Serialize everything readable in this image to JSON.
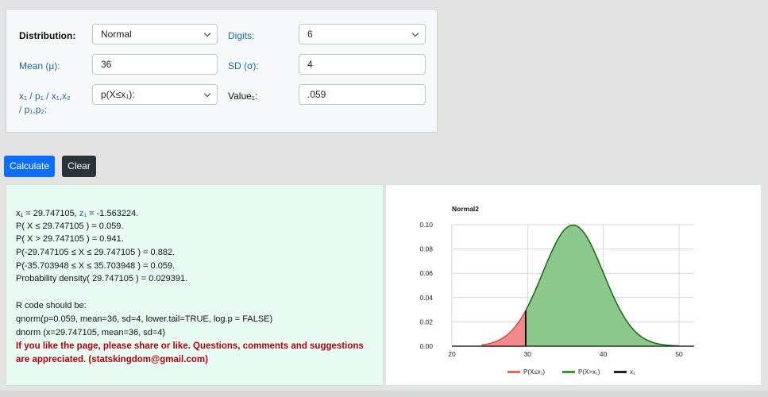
{
  "form": {
    "distribution_label": "Distribution:",
    "distribution_value": "Normal",
    "digits_label": "Digits:",
    "digits_value": "6",
    "mean_label": "Mean (μ):",
    "mean_value": "36",
    "sd_label": "SD (σ):",
    "sd_value": "4",
    "mode_label_1": "x₁ / p₁ / x₁,x₂",
    "mode_label_2": "/ p₁,p₂:",
    "mode_value": "p(X≤x₁):",
    "value1_label": "Value₁:",
    "value1_value": ".059"
  },
  "buttons": {
    "calculate": "Calculate",
    "clear": "Clear"
  },
  "results": {
    "x1_label": "x₁ = 29.747105,",
    "z1_label": "z₁",
    "z1_value": "= -1.563224.",
    "lines": [
      "P( X ≤ 29.747105 ) = 0.059.",
      "P( X > 29.747105 ) = 0.941.",
      "P(-29.747105 ≤ X ≤ 29.747105 ) = 0.882.",
      "P(-35.703948 ≤ X ≤ 35.703948 ) = 0.059.",
      "Probability density( 29.747105 ) = 0.029391."
    ],
    "r_title": "R code should be:",
    "r_lines": [
      "qnorm(p=0.059, mean=36, sd=4, lower.tail=TRUE, log.p = FALSE)",
      "dnorm (x=29.747105, mean=36, sd=4)"
    ],
    "message_1": "If you like the page, please share or like. Questions, comments and suggestions",
    "message_2": "are appreciated. (statskingdom@gmail.com)"
  },
  "chart_data": {
    "type": "area",
    "title": "Normal2",
    "mean": 36,
    "sd": 4,
    "cutoff": 29.747105,
    "xlim": [
      20,
      52
    ],
    "ylim": [
      0,
      0.1
    ],
    "x_ticks": [
      20,
      30,
      40,
      50
    ],
    "y_ticks": [
      "0.00",
      "0.02",
      "0.04",
      "0.06",
      "0.08",
      "0.10"
    ],
    "y_tick_values": [
      0,
      0.02,
      0.04,
      0.06,
      0.08,
      0.1
    ],
    "series": [
      {
        "name": "P(X≤x₁)",
        "color": "#ff6b6b"
      },
      {
        "name": "P(X>x₁)",
        "color": "#2e8b2e"
      },
      {
        "name": "x₁",
        "color": "#222222"
      }
    ],
    "legend_position": "bottom"
  }
}
